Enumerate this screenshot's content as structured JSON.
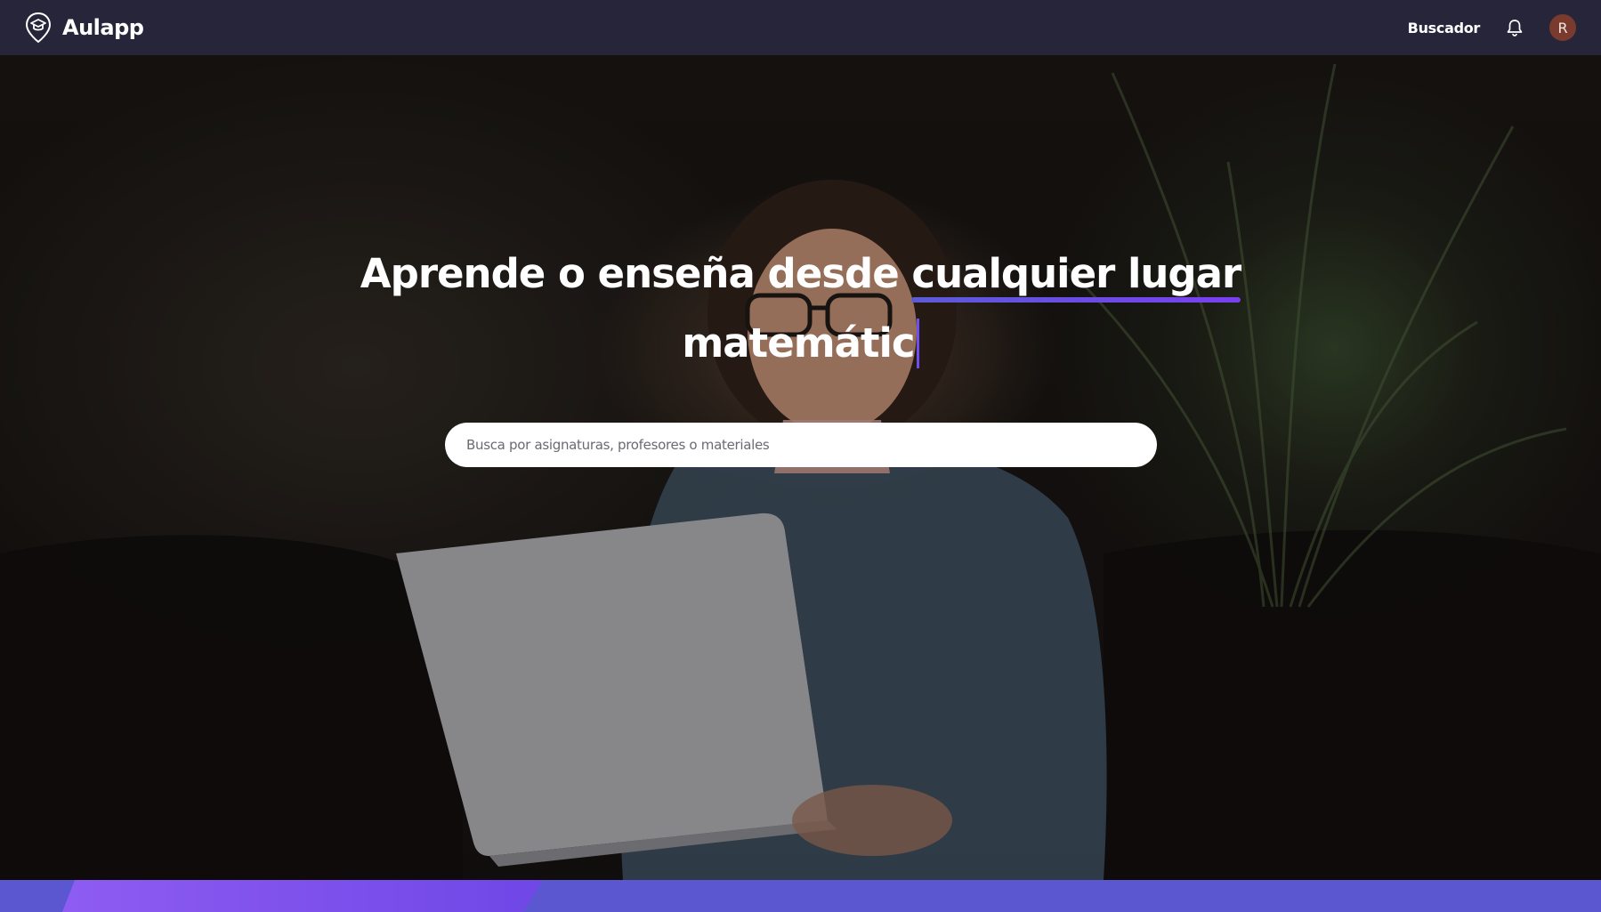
{
  "app": {
    "name": "Aulapp",
    "logo_icon": "graduation-cap-pin-icon"
  },
  "nav": {
    "search_link": "Buscador",
    "bell_icon": "bell-icon",
    "avatar_initial": "R"
  },
  "hero": {
    "headline_prefix": "Aprende o enseña desde ",
    "headline_highlight": "cualquier lugar",
    "typed_text": "matemátic",
    "search_placeholder": "Busca por asignaturas, profesores o materiales"
  },
  "colors": {
    "navbar_bg": "#26253a",
    "accent": "#6d4ff0",
    "underline_gradient_start": "#5b5bd6",
    "underline_gradient_end": "#7a3ff0",
    "bottom_band": "#5a57d0",
    "avatar_bg": "#7a3b2e"
  }
}
